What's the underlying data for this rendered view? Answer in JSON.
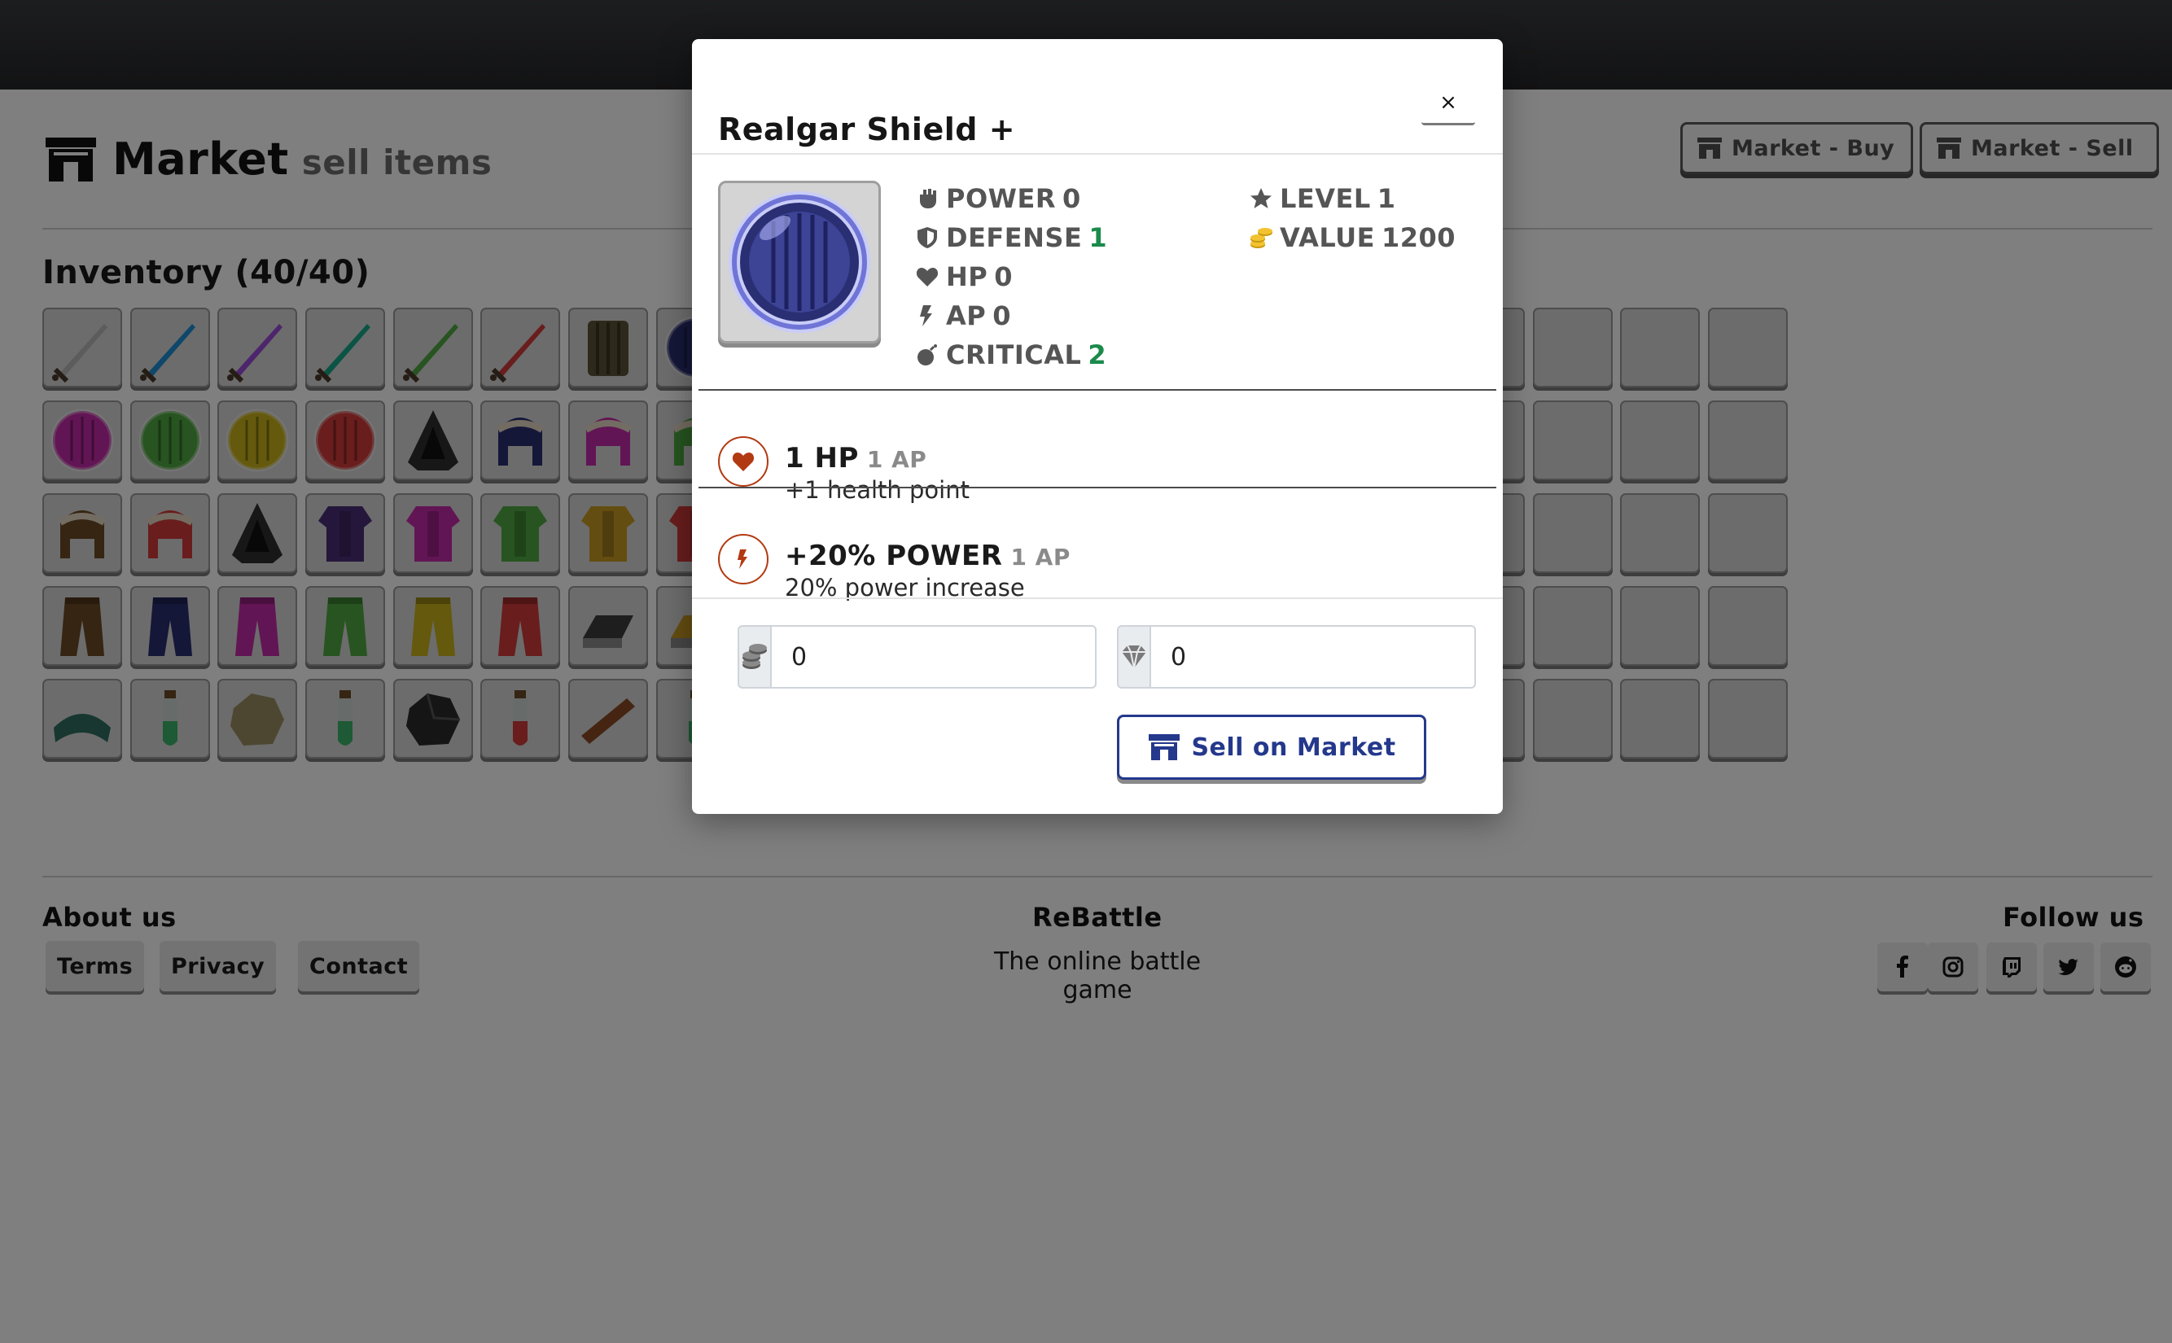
{
  "header": {
    "title": "Market",
    "subtitle": "sell items",
    "nav": {
      "buy_label": "Market - Buy",
      "sell_label": "Market - Sell"
    }
  },
  "inventory": {
    "title": "Inventory (40/40)",
    "slots": [
      "sword",
      "sword-blue",
      "sword-violet",
      "sword-teal",
      "sword-green",
      "sword-red",
      "wood-shield",
      "round-shield-navy",
      "empty",
      "empty",
      "empty",
      "empty",
      "empty",
      "empty",
      "empty",
      "empty",
      "empty",
      "empty",
      "empty",
      "empty",
      "shield-magenta",
      "shield-green",
      "shield-yellow",
      "shield-red",
      "hood-black",
      "fur-hood-navy",
      "fur-hood-magenta",
      "fur-hood-green",
      "empty",
      "empty",
      "empty",
      "empty",
      "empty",
      "empty",
      "empty",
      "empty",
      "empty",
      "empty",
      "empty",
      "empty",
      "fur-hood-brown",
      "fur-hood-red",
      "cloak-black",
      "armor-purple",
      "armor-magenta",
      "armor-green",
      "armor-gold",
      "armor-red",
      "empty",
      "empty",
      "empty",
      "empty",
      "empty",
      "empty",
      "empty",
      "empty",
      "empty",
      "empty",
      "empty",
      "empty",
      "pants-brown",
      "pants-navy",
      "pants-magenta",
      "pants-green",
      "pants-yellow",
      "pants-red",
      "ingot-iron",
      "ingot-gold",
      "empty",
      "empty",
      "empty",
      "empty",
      "empty",
      "empty",
      "empty",
      "empty",
      "empty",
      "empty",
      "empty",
      "empty",
      "cloth-teal",
      "potion-green",
      "ore-stone",
      "potion-green",
      "ore-coal",
      "potion-red",
      "plank-wood",
      "potion-green",
      "empty",
      "empty",
      "empty",
      "empty",
      "empty",
      "empty",
      "empty",
      "empty",
      "empty",
      "empty",
      "empty",
      "empty"
    ]
  },
  "footer": {
    "about": "About us",
    "terms": "Terms",
    "privacy": "Privacy",
    "contact": "Contact",
    "brand": "ReBattle",
    "tagline": "The online battle game",
    "follow": "Follow us",
    "social_icons": [
      "facebook-icon",
      "instagram-icon",
      "twitch-icon",
      "twitter-icon",
      "reddit-icon"
    ]
  },
  "modal": {
    "title": "Realgar Shield +",
    "close": "×",
    "item_icon": "round-shield-blue",
    "stats": {
      "power_label": "POWER",
      "power": "0",
      "defense_label": "DEFENSE",
      "defense": "1",
      "hp_label": "HP",
      "hp": "0",
      "ap_label": "AP",
      "ap": "0",
      "critical_label": "CRITICAL",
      "critical": "2",
      "level_label": "LEVEL",
      "level": "1",
      "value_label": "VALUE",
      "value": "1200"
    },
    "skills": [
      {
        "name": "1 HP",
        "ap": "1 AP",
        "desc": "+1 health point",
        "icon": "heart-icon"
      },
      {
        "name": "+20% POWER",
        "ap": "1 AP",
        "desc": "20% power increase",
        "icon": "bolt-icon"
      }
    ],
    "price": {
      "gold": "0",
      "gems": "0"
    },
    "sell_label": "Sell on Market"
  },
  "colors": {
    "accent": "#24388c",
    "positive": "#1b8a4b",
    "skill_ring": "#b23a12",
    "gold": "#d9a515",
    "backdrop": "rgba(0,0,0,0.5)"
  }
}
